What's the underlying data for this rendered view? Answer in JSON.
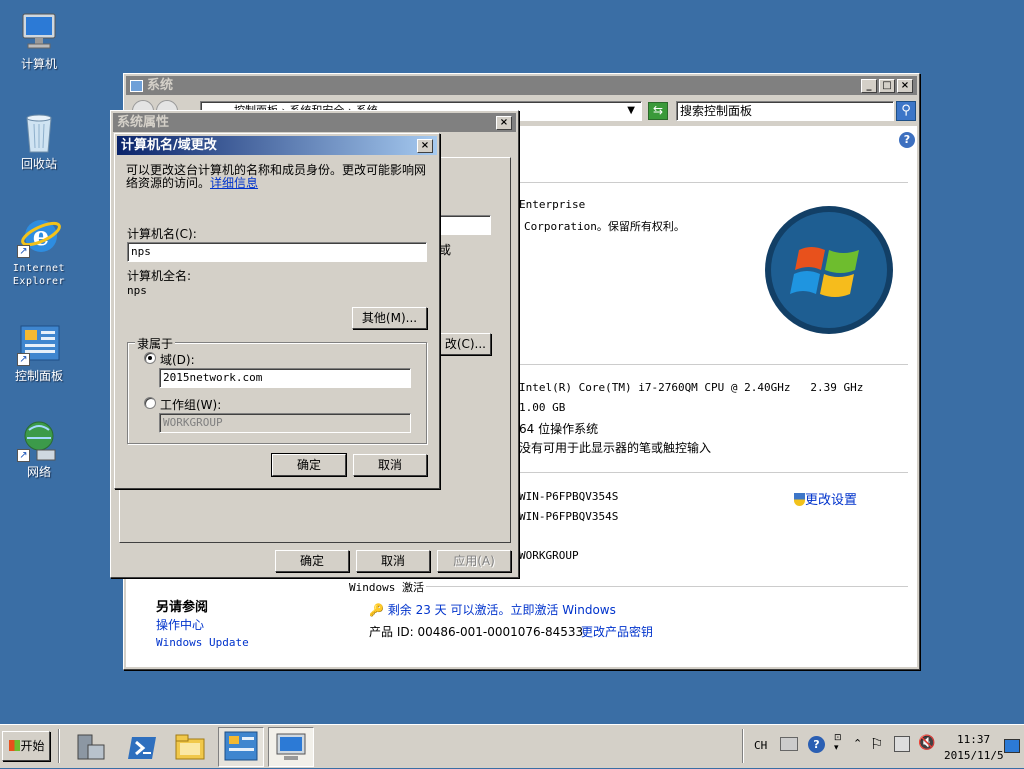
{
  "desktop": {
    "icons": [
      {
        "label": "计算机"
      },
      {
        "label": "回收站"
      },
      {
        "label": "Internet\nExplorer"
      },
      {
        "label": "控制面板"
      },
      {
        "label": "网络"
      }
    ]
  },
  "system_window": {
    "title": "系统",
    "address_parts": [
      "控制面板",
      "系统和安全",
      "系统"
    ],
    "search_placeholder": "搜索控制面板",
    "edition": "Enterprise",
    "copyright": "Corporation。保留所有权利。",
    "system": {
      "processor": "Intel(R) Core(TM) i7-2760QM CPU @ 2.40GHz   2.39 GHz",
      "memory": "1.00 GB",
      "type": "64 位操作系统",
      "pen": "没有可用于此显示器的笔或触控输入"
    },
    "computer": {
      "name": "WIN-P6FPBQV354S",
      "full_name": "WIN-P6FPBQV354S",
      "workgroup": "WORKGROUP",
      "change_settings": "更改设置"
    },
    "activation": {
      "header": "Windows 激活",
      "remaining": "剩余 23 天 可以激活。立即激活 Windows",
      "product_id": "产品 ID: 00486-001-0001076-84533",
      "change_key": "更改产品密钥"
    },
    "see_also": {
      "title": "另请参阅",
      "links": [
        "操作中心",
        "Windows Update"
      ]
    }
  },
  "sys_props": {
    "title": "系统属性",
    "ok": "确定",
    "cancel": "取消",
    "apply": "应用(A)",
    "change_btn": "改(C)...",
    "partial_text": "或"
  },
  "dialog": {
    "title": "计算机名/域更改",
    "description": "可以更改这台计算机的名称和成员身份。更改可能影响网络资源的访问。",
    "details_link": "详细信息",
    "computer_name_label": "计算机名(C):",
    "computer_name_value": "nps",
    "full_name_label": "计算机全名:",
    "full_name_value": "nps",
    "more_button": "其他(M)...",
    "member_of": "隶属于",
    "domain_label": "域(D):",
    "domain_value": "2015network.com",
    "workgroup_label": "工作组(W):",
    "workgroup_value": "WORKGROUP",
    "ok": "确定",
    "cancel": "取消"
  },
  "taskbar": {
    "start": "开始",
    "lang": "CH",
    "time": "11:37",
    "date": "2015/11/5"
  },
  "colors": {
    "desktop": "#3a6ea5",
    "title_active": "#0a246a",
    "link": "#0033cc"
  }
}
